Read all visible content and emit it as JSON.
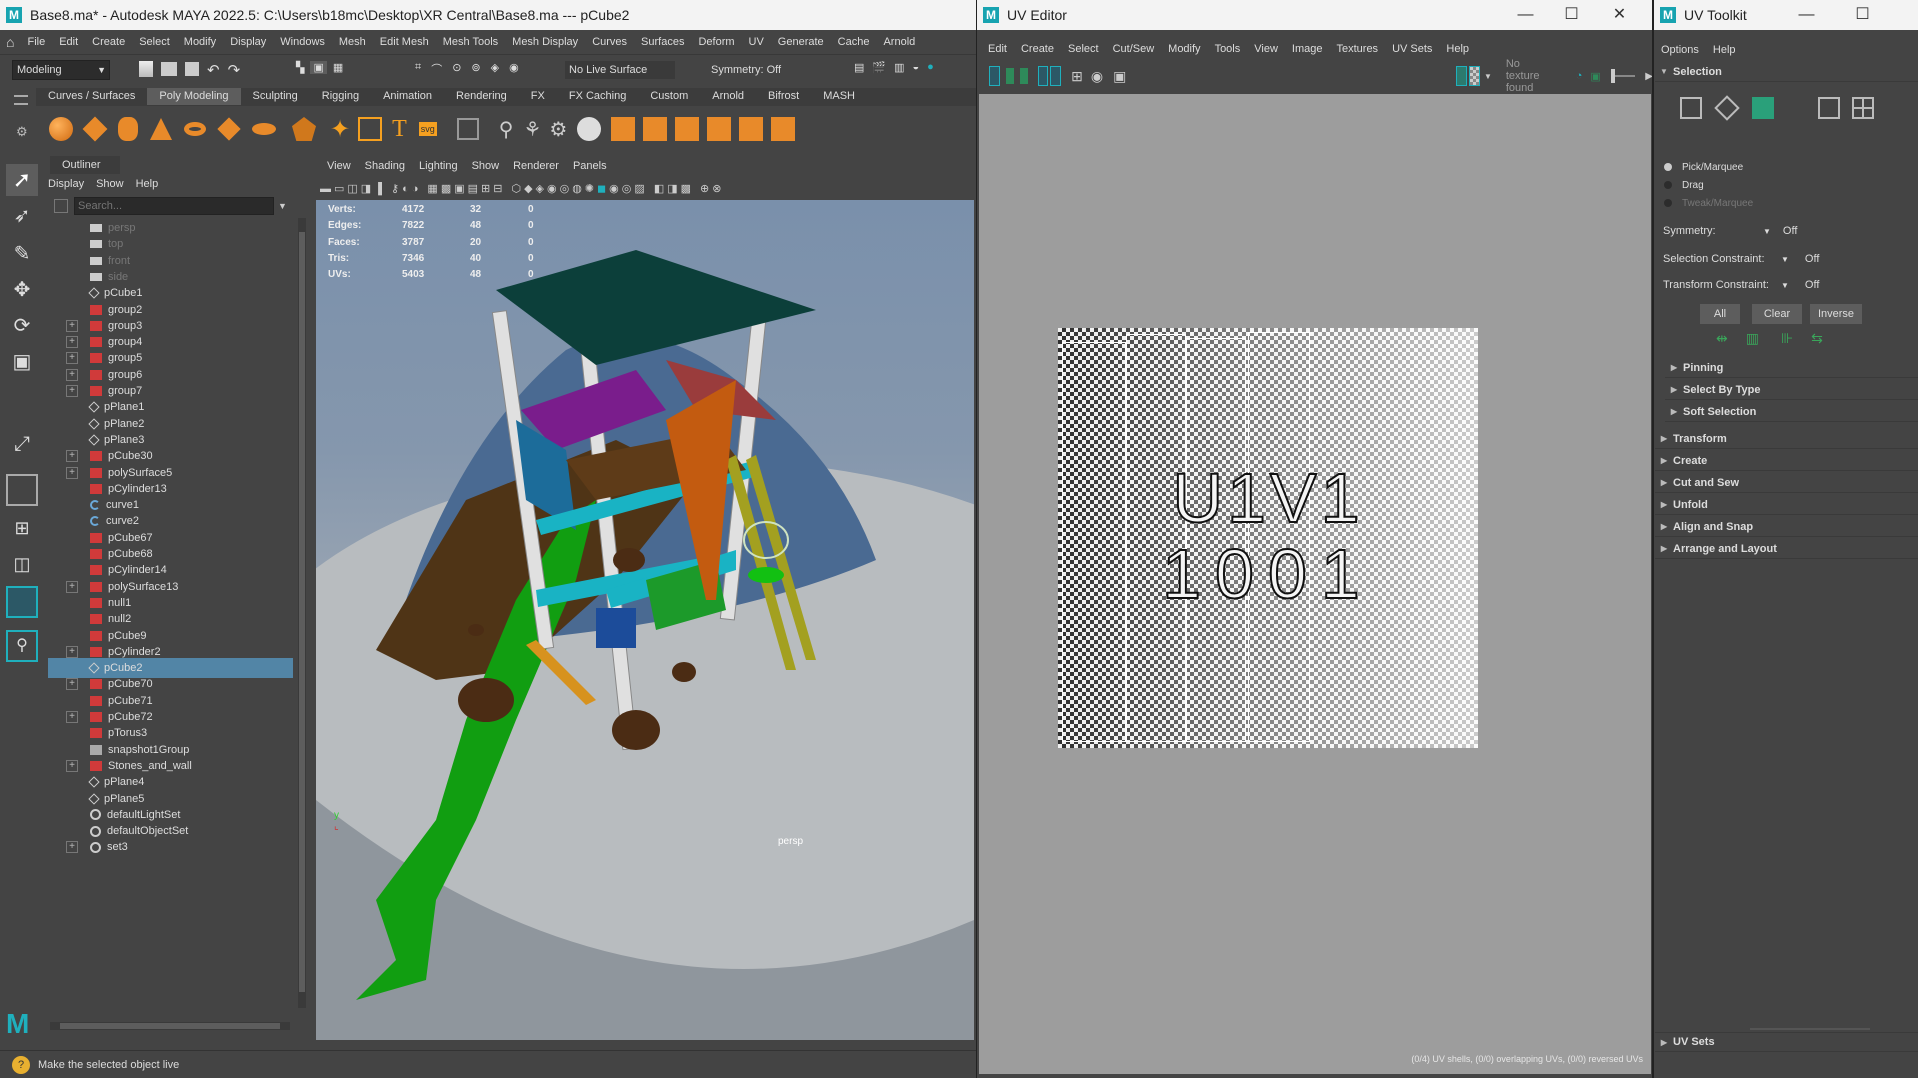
{
  "maya": {
    "title": "Base8.ma* - Autodesk MAYA 2022.5: C:\\Users\\b18mc\\Desktop\\XR Central\\Base8.ma   ---   pCube2",
    "menu": [
      "File",
      "Edit",
      "Create",
      "Select",
      "Modify",
      "Display",
      "Windows",
      "Mesh",
      "Edit Mesh",
      "Mesh Tools",
      "Mesh Display",
      "Curves",
      "Surfaces",
      "Deform",
      "UV",
      "Generate",
      "Cache",
      "Arnold"
    ],
    "mode_dropdown": "Modeling",
    "live_surface": "No Live Surface",
    "symmetry": "Symmetry: Off",
    "shelf_tabs": [
      "Curves / Surfaces",
      "Poly Modeling",
      "Sculpting",
      "Rigging",
      "Animation",
      "Rendering",
      "FX",
      "FX Caching",
      "Custom",
      "Arnold",
      "Bifrost",
      "MASH"
    ],
    "shelf_active": 1,
    "outliner": {
      "title": "Outliner",
      "menu": [
        "Display",
        "Show",
        "Help"
      ],
      "search_placeholder": "Search...",
      "items": [
        {
          "name": "persp",
          "type": "camera",
          "exp": false,
          "dim": true
        },
        {
          "name": "top",
          "type": "camera",
          "exp": false,
          "dim": true
        },
        {
          "name": "front",
          "type": "camera",
          "exp": false,
          "dim": true
        },
        {
          "name": "side",
          "type": "camera",
          "exp": false,
          "dim": true
        },
        {
          "name": "pCube1",
          "type": "mesh",
          "exp": false
        },
        {
          "name": "group2",
          "type": "group",
          "exp": false
        },
        {
          "name": "group3",
          "type": "group",
          "exp": true
        },
        {
          "name": "group4",
          "type": "group",
          "exp": true
        },
        {
          "name": "group5",
          "type": "group",
          "exp": true
        },
        {
          "name": "group6",
          "type": "group",
          "exp": true
        },
        {
          "name": "group7",
          "type": "group",
          "exp": true
        },
        {
          "name": "pPlane1",
          "type": "mesh",
          "exp": false
        },
        {
          "name": "pPlane2",
          "type": "mesh",
          "exp": false
        },
        {
          "name": "pPlane3",
          "type": "mesh",
          "exp": false
        },
        {
          "name": "pCube30",
          "type": "group",
          "exp": true
        },
        {
          "name": "polySurface5",
          "type": "group",
          "exp": true
        },
        {
          "name": "pCylinder13",
          "type": "group",
          "exp": false
        },
        {
          "name": "curve1",
          "type": "curve",
          "exp": false
        },
        {
          "name": "curve2",
          "type": "curve",
          "exp": false
        },
        {
          "name": "pCube67",
          "type": "group",
          "exp": false
        },
        {
          "name": "pCube68",
          "type": "group",
          "exp": false
        },
        {
          "name": "pCylinder14",
          "type": "group",
          "exp": false
        },
        {
          "name": "polySurface13",
          "type": "group",
          "exp": true
        },
        {
          "name": "null1",
          "type": "group",
          "exp": false
        },
        {
          "name": "null2",
          "type": "group",
          "exp": false
        },
        {
          "name": "pCube9",
          "type": "group",
          "exp": false
        },
        {
          "name": "pCylinder2",
          "type": "group",
          "exp": true
        },
        {
          "name": "pCube2",
          "type": "mesh",
          "exp": false,
          "sel": true
        },
        {
          "name": "pCube70",
          "type": "group",
          "exp": true
        },
        {
          "name": "pCube71",
          "type": "group",
          "exp": false
        },
        {
          "name": "pCube72",
          "type": "group",
          "exp": true
        },
        {
          "name": "pTorus3",
          "type": "group",
          "exp": false
        },
        {
          "name": "snapshot1Group",
          "type": "snapshot",
          "exp": false
        },
        {
          "name": "Stones_and_wall",
          "type": "group",
          "exp": true
        },
        {
          "name": "pPlane4",
          "type": "mesh",
          "exp": false
        },
        {
          "name": "pPlane5",
          "type": "mesh",
          "exp": false
        },
        {
          "name": "defaultLightSet",
          "type": "set",
          "exp": false
        },
        {
          "name": "defaultObjectSet",
          "type": "set",
          "exp": false
        },
        {
          "name": "set3",
          "type": "set",
          "exp": true
        }
      ]
    },
    "viewport": {
      "menu": [
        "View",
        "Shading",
        "Lighting",
        "Show",
        "Renderer",
        "Panels"
      ],
      "stats": [
        {
          "label": "Verts:",
          "a": "4172",
          "b": "32",
          "c": "0"
        },
        {
          "label": "Edges:",
          "a": "7822",
          "b": "48",
          "c": "0"
        },
        {
          "label": "Faces:",
          "a": "3787",
          "b": "20",
          "c": "0"
        },
        {
          "label": "Tris:",
          "a": "7346",
          "b": "40",
          "c": "0"
        },
        {
          "label": "UVs:",
          "a": "5403",
          "b": "48",
          "c": "0"
        }
      ],
      "camera_label": "persp"
    },
    "help_line": "Make the selected object live"
  },
  "uv_editor": {
    "title": "UV Editor",
    "menu": [
      "Edit",
      "Create",
      "Select",
      "Cut/Sew",
      "Modify",
      "Tools",
      "View",
      "Image",
      "Textures",
      "UV Sets",
      "Help"
    ],
    "texture_status": "No texture found",
    "tile_label_1": "U1V1",
    "tile_label_2": "1001",
    "footer": "(0/4) UV shells, (0/0) overlapping UVs, (0/0) reversed UVs"
  },
  "uv_toolkit": {
    "title": "UV Toolkit",
    "menu": [
      "Options",
      "Help"
    ],
    "selection_header": "Selection",
    "radio_options": [
      "Pick/Marquee",
      "Drag",
      "Tweak/Marquee"
    ],
    "symmetry_label": "Symmetry:",
    "symmetry_value": "Off",
    "selection_constraint_label": "Selection Constraint:",
    "selection_constraint_value": "Off",
    "transform_constraint_label": "Transform Constraint:",
    "transform_constraint_value": "Off",
    "btn_all": "All",
    "btn_clear": "Clear",
    "btn_inverse": "Inverse",
    "subsections": [
      "Pinning",
      "Select By Type",
      "Soft Selection"
    ],
    "sections": [
      "Transform",
      "Create",
      "Cut and Sew",
      "Unfold",
      "Align and Snap",
      "Arrange and Layout"
    ],
    "uv_sets": "UV Sets"
  },
  "colors": {
    "selection_blue": "#5285a6",
    "panel_bg": "#444444",
    "viewport_top": "#7a8fa8",
    "viewport_floor": "#b5b9bc"
  }
}
